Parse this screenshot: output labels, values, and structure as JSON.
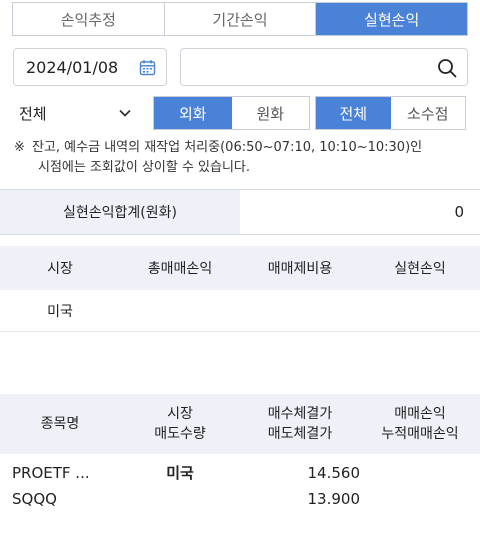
{
  "tabs": [
    {
      "label": "손익추정",
      "active": false
    },
    {
      "label": "기간손익",
      "active": false
    },
    {
      "label": "실현손익",
      "active": true
    }
  ],
  "date": {
    "value": "2024/01/08",
    "icon": "calendar-icon"
  },
  "search": {
    "value": "",
    "placeholder": "",
    "icon": "search-icon"
  },
  "filter": {
    "market_select": {
      "value": "전체",
      "icon": "chevron-down-icon"
    },
    "currency": {
      "options": [
        "외화",
        "원화"
      ],
      "selected": "외화"
    },
    "lot": {
      "options": [
        "전체",
        "소수점"
      ],
      "selected": "전체"
    }
  },
  "notice": {
    "mark": "※",
    "line1": "잔고, 예수금 내역의 재작업 처리중(06:50~07:10, 10:10~10:30)인",
    "line2": "시점에는 조회값이 상이할 수 있습니다."
  },
  "summary": {
    "label": "실현손익합계(원화)",
    "value": "0"
  },
  "table1": {
    "headers": [
      "시장",
      "총매매손익",
      "매매제비용",
      "실현손익"
    ],
    "rows": [
      [
        "미국",
        "",
        "",
        ""
      ]
    ]
  },
  "table2": {
    "headers": [
      [
        "종목명"
      ],
      [
        "시장",
        "매도수량"
      ],
      [
        "매수체결가",
        "매도체결가"
      ],
      [
        "매매손익",
        "누적매매손익"
      ]
    ],
    "rows": [
      {
        "name": "PROETF ...",
        "ticker": "SQQQ",
        "market": "미국",
        "buy_price": "14.560",
        "sell_price": "13.900",
        "pl": "",
        "cum_pl": ""
      }
    ]
  },
  "colors": {
    "accent": "#4a82d8",
    "header_bg": "#eef1f7",
    "border": "#c9cdd6"
  }
}
